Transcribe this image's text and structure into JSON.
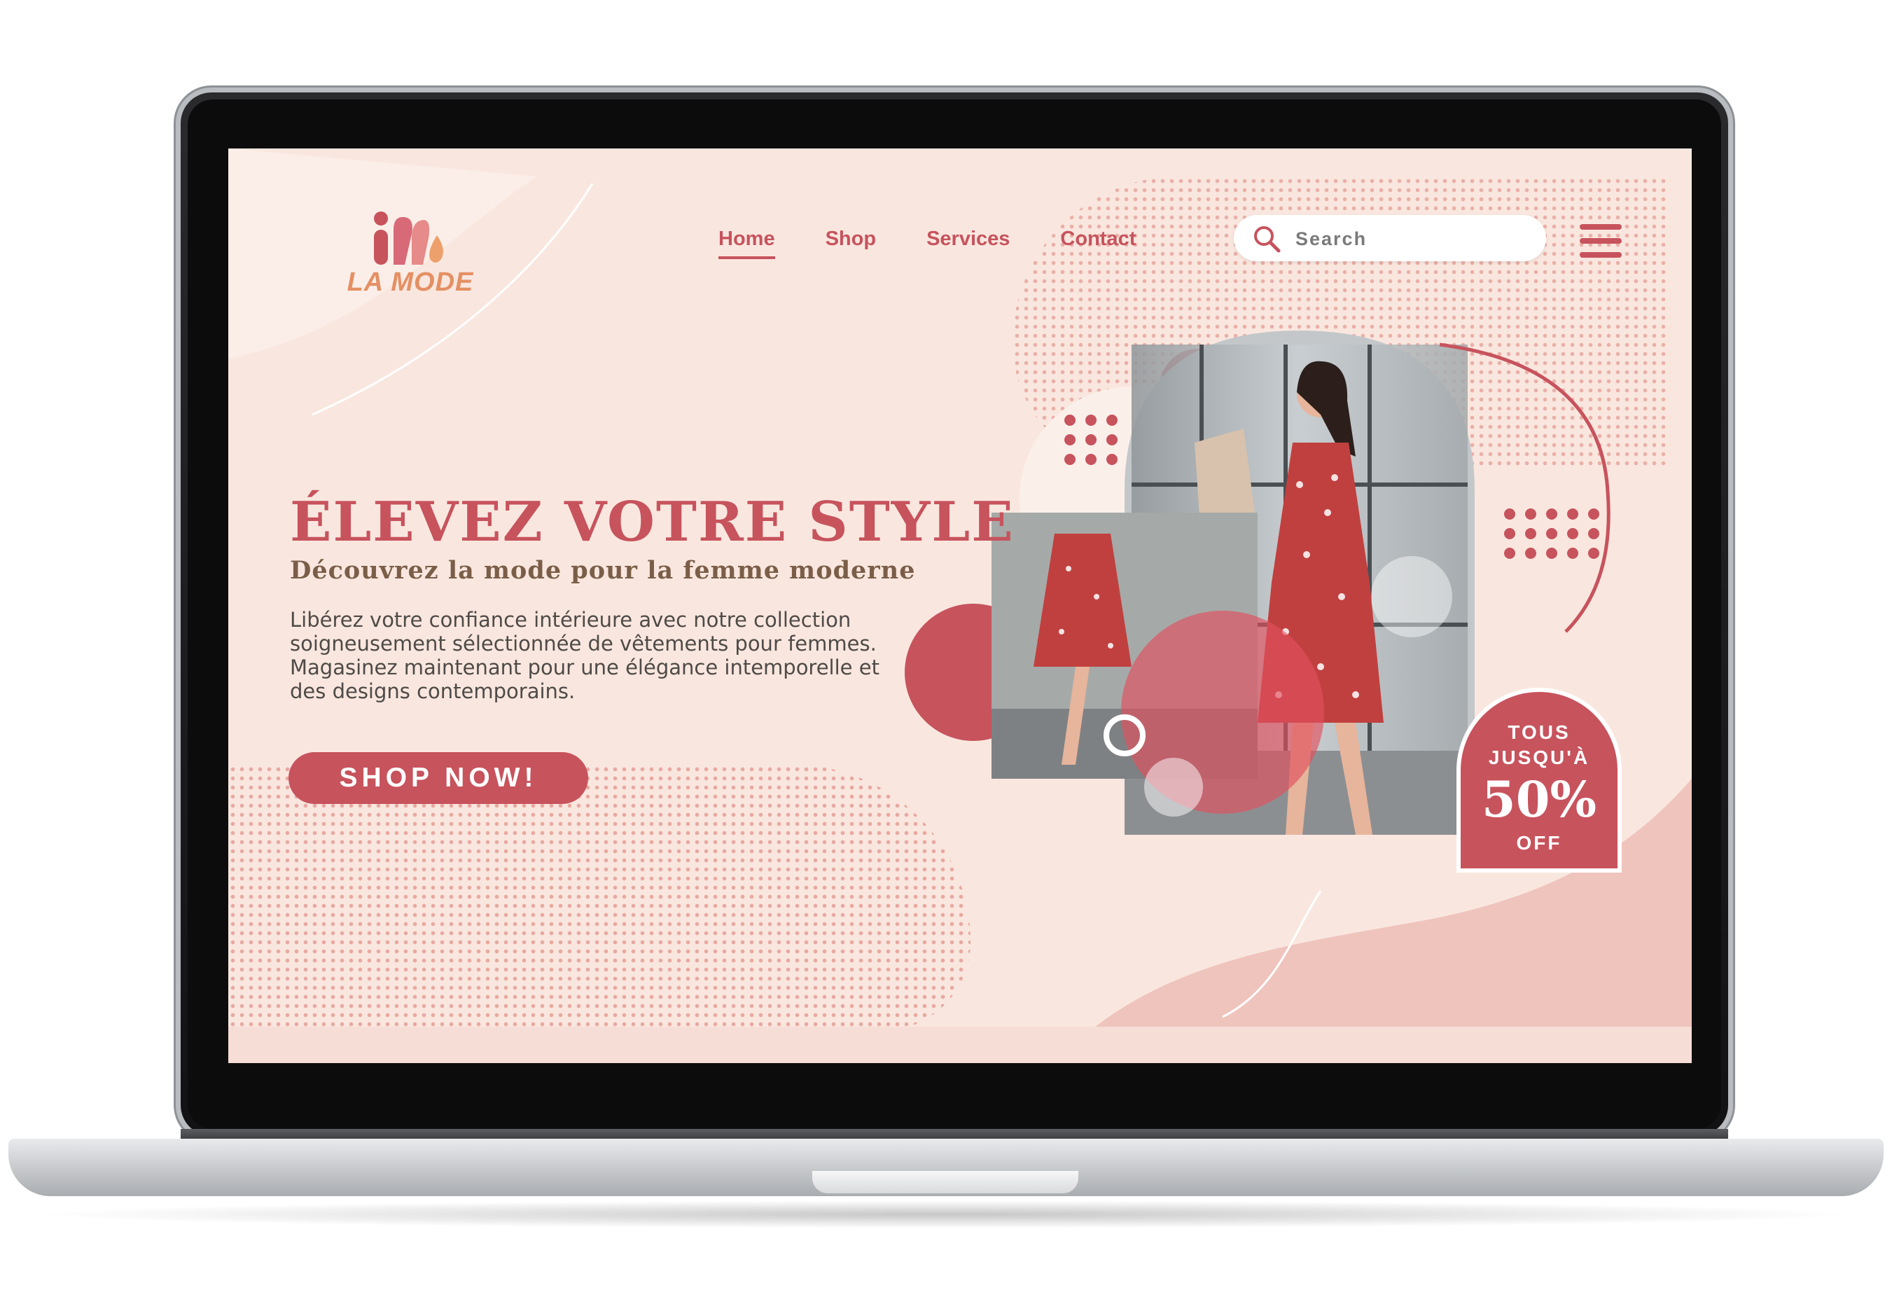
{
  "brand": {
    "name": "LA MODE"
  },
  "nav": {
    "items": [
      "Home",
      "Shop",
      "Services",
      "Contact"
    ],
    "active": "Home"
  },
  "search": {
    "placeholder": "Search"
  },
  "hero": {
    "headline": "ÉLEVEZ VOTRE STYLE",
    "subheadline": "Découvrez la mode pour la femme moderne",
    "body": "Libérez votre confiance intérieure avec notre collection soigneusement sélectionnée de vêtements pour femmes. Magasinez maintenant pour une élégance intemporelle et des designs contemporains.",
    "cta_label": "SHOP NOW!"
  },
  "promo": {
    "line1": "TOUS",
    "line2": "JUSQU'À",
    "value": "50%",
    "suffix": "OFF"
  },
  "colors": {
    "accent": "#c7535d",
    "background": "#f9e7df",
    "logo_text": "#e49064",
    "subheadline": "#7a5e48"
  },
  "icons": [
    "logo-mark-icon",
    "search-icon",
    "hamburger-menu-icon"
  ]
}
